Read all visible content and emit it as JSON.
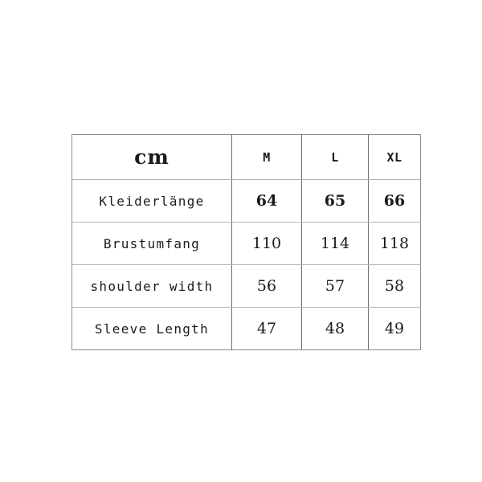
{
  "chart_data": {
    "type": "table",
    "title": "",
    "unit_label": "cm",
    "columns": [
      "cm",
      "M",
      "L",
      "XL"
    ],
    "rows": [
      {
        "label": "Kleiderlänge",
        "values": [
          "64",
          "65",
          "66"
        ],
        "emphasis": true
      },
      {
        "label": "Brustumfang",
        "values": [
          "110",
          "114",
          "118"
        ],
        "emphasis": false
      },
      {
        "label": "shoulder width",
        "values": [
          "56",
          "57",
          "58"
        ],
        "emphasis": false
      },
      {
        "label": "Sleeve Length",
        "values": [
          "47",
          "48",
          "49"
        ],
        "emphasis": false
      }
    ]
  },
  "table": {
    "unit_header": "cm",
    "size_headers": [
      "M",
      "L",
      "XL"
    ],
    "rows": [
      {
        "label": "Kleiderlänge",
        "m": "64",
        "l": "65",
        "xl": "66"
      },
      {
        "label": "Brustumfang",
        "m": "110",
        "l": "114",
        "xl": "118"
      },
      {
        "label": "shoulder width",
        "m": "56",
        "l": "57",
        "xl": "58"
      },
      {
        "label": "Sleeve Length",
        "m": "47",
        "l": "48",
        "xl": "49"
      }
    ]
  },
  "colors": {
    "background": "#ffffff",
    "text": "#1b1b1b",
    "outer_border": "#8e8e8e",
    "vertical_rule": "#6f6f6f",
    "horizontal_rule": "#b4b4b4"
  }
}
